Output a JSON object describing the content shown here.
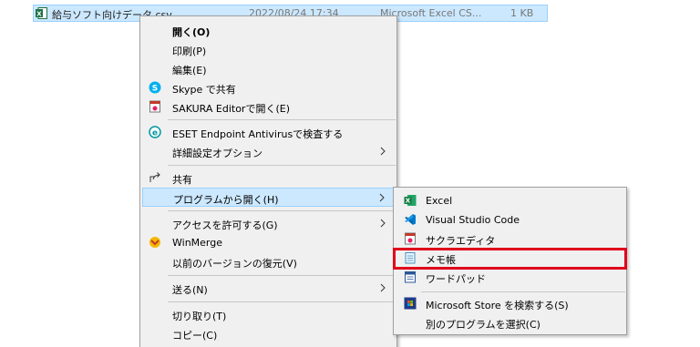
{
  "file": {
    "name": "給与ソフト向けデータ.csv",
    "date": "2022/08/24 17:34",
    "type": "Microsoft Excel CS...",
    "size": "1 KB"
  },
  "context_menu": {
    "open": "開く(O)",
    "print": "印刷(P)",
    "edit": "編集(E)",
    "skype_share": "Skype で共有",
    "sakura_open": "SAKURA Editorで開く(E)",
    "eset_scan": "ESET Endpoint Antivirusで検査する",
    "advanced_options": "詳細設定オプション",
    "share": "共有",
    "open_with": "プログラムから開く(H)",
    "give_access": "アクセスを許可する(G)",
    "winmerge": "WinMerge",
    "restore_versions": "以前のバージョンの復元(V)",
    "send_to": "送る(N)",
    "cut": "切り取り(T)",
    "copy": "コピー(C)"
  },
  "open_with_menu": {
    "excel": "Excel",
    "vscode": "Visual Studio Code",
    "sakura": "サクラエディタ",
    "notepad": "メモ帳",
    "wordpad": "ワードパッド",
    "store_search": "Microsoft Store を検索する(S)",
    "choose_other": "別のプログラムを選択(C)"
  },
  "colors": {
    "highlight": "#cce8ff",
    "annotation_box": "#e0001b"
  }
}
